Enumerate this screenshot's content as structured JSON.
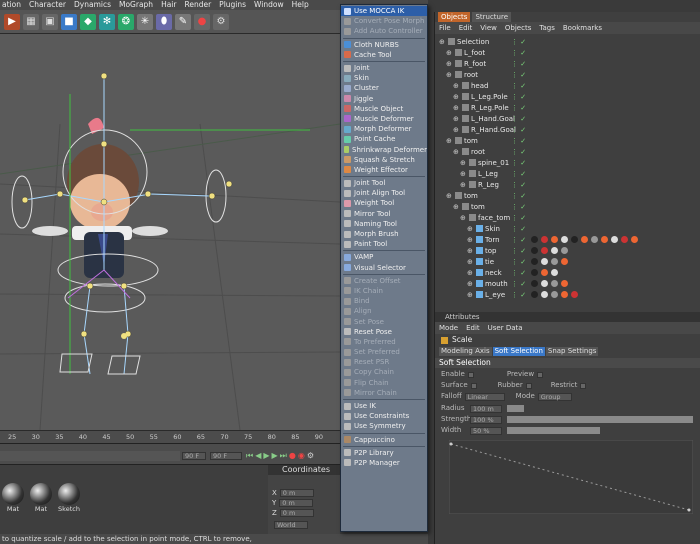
{
  "menubar": {
    "items": [
      "ation",
      "Character",
      "Dynamics",
      "MoGraph",
      "Hair",
      "Render",
      "Plugins",
      "Window",
      "Help"
    ]
  },
  "toolbar": {
    "icons": [
      "render-icon",
      "render-region-icon",
      "render-view-icon",
      "cube-icon",
      "nurbs-icon",
      "array-icon",
      "deformer-icon",
      "scene-icon",
      "light-icon",
      "camera-icon",
      "record-icon",
      "python-icon"
    ]
  },
  "viewport": {
    "ruler_ticks": [
      "25",
      "30",
      "35",
      "40",
      "45",
      "50",
      "55",
      "60",
      "65",
      "70",
      "75",
      "80",
      "85",
      "90"
    ]
  },
  "timeline": {
    "frame_a": "90 F",
    "frame_b": "90 F"
  },
  "materials": {
    "items": [
      "Mat",
      "Mat",
      "Sketch"
    ]
  },
  "coordinates": {
    "title": "Coordinates",
    "rows": [
      {
        "axis": "X",
        "value": "0 m"
      },
      {
        "axis": "Y",
        "value": "0 m"
      },
      {
        "axis": "Z",
        "value": "0 m"
      }
    ],
    "mode": "World"
  },
  "status": "to quantize scale / add to the selection in point mode, CTRL to remove,",
  "plugins_menu": {
    "items": [
      {
        "label": "Use MOCCA IK",
        "state": "sel",
        "color": "#cfe0ff"
      },
      {
        "label": "Convert Pose Morph",
        "state": "dis",
        "color": "#999"
      },
      {
        "label": "Add Auto Controller",
        "state": "dis",
        "color": "#999"
      },
      {
        "sep": true
      },
      {
        "label": "Cloth NURBS",
        "state": "",
        "color": "#4a8fd8"
      },
      {
        "label": "Cache Tool",
        "state": "",
        "color": "#d86a4a"
      },
      {
        "sep": true
      },
      {
        "label": "Joint",
        "state": "",
        "color": "#bbb"
      },
      {
        "label": "Skin",
        "state": "",
        "color": "#8ab"
      },
      {
        "label": "Cluster",
        "state": "",
        "color": "#9ac"
      },
      {
        "label": "Jiggle",
        "state": "",
        "color": "#c8a"
      },
      {
        "label": "Muscle Object",
        "state": "",
        "color": "#c66"
      },
      {
        "label": "Muscle Deformer",
        "state": "",
        "color": "#a6c"
      },
      {
        "label": "Morph Deformer",
        "state": "",
        "color": "#6ac"
      },
      {
        "label": "Point Cache",
        "state": "",
        "color": "#6ca"
      },
      {
        "label": "Shrinkwrap Deformer",
        "state": "",
        "color": "#ac6"
      },
      {
        "label": "Squash & Stretch",
        "state": "",
        "color": "#c96"
      },
      {
        "label": "Weight Effector",
        "state": "",
        "color": "#d84"
      },
      {
        "sep": true
      },
      {
        "label": "Joint Tool",
        "state": "",
        "color": "#bbb"
      },
      {
        "label": "Joint Align Tool",
        "state": "",
        "color": "#bbb"
      },
      {
        "label": "Weight Tool",
        "state": "",
        "color": "#d9a"
      },
      {
        "label": "Mirror Tool",
        "state": "",
        "color": "#bbb"
      },
      {
        "label": "Naming Tool",
        "state": "",
        "color": "#bbb"
      },
      {
        "label": "Morph Brush",
        "state": "",
        "color": "#bbb"
      },
      {
        "label": "Paint Tool",
        "state": "",
        "color": "#bbb"
      },
      {
        "sep": true
      },
      {
        "label": "VAMP",
        "state": "",
        "color": "#8ad"
      },
      {
        "label": "Visual Selector",
        "state": "",
        "color": "#8ad"
      },
      {
        "sep": true
      },
      {
        "label": "Create Offset",
        "state": "dis",
        "color": "#999"
      },
      {
        "label": "IK Chain",
        "state": "dis",
        "color": "#999"
      },
      {
        "label": "Bind",
        "state": "dis",
        "color": "#999"
      },
      {
        "label": "Align",
        "state": "dis",
        "color": "#999"
      },
      {
        "label": "Set Pose",
        "state": "dis",
        "color": "#999"
      },
      {
        "label": "Reset Pose",
        "state": "",
        "color": "#bbb"
      },
      {
        "label": "To Preferred",
        "state": "dis",
        "color": "#999"
      },
      {
        "label": "Set Preferred",
        "state": "dis",
        "color": "#999"
      },
      {
        "label": "Reset PSR",
        "state": "dis",
        "color": "#999"
      },
      {
        "label": "Copy Chain",
        "state": "dis",
        "color": "#999"
      },
      {
        "label": "Flip Chain",
        "state": "dis",
        "color": "#999"
      },
      {
        "label": "Mirror Chain",
        "state": "dis",
        "color": "#999"
      },
      {
        "sep": true
      },
      {
        "label": "Use IK",
        "state": "",
        "color": "#bbb"
      },
      {
        "label": "Use Constraints",
        "state": "",
        "color": "#bbb"
      },
      {
        "label": "Use Symmetry",
        "state": "",
        "color": "#bbb"
      },
      {
        "sep": true
      },
      {
        "label": "Cappuccino",
        "state": "",
        "color": "#a86"
      },
      {
        "sep": true
      },
      {
        "label": "P2P Library",
        "state": "",
        "color": "#bbb"
      },
      {
        "label": "P2P Manager",
        "state": "",
        "color": "#bbb"
      }
    ]
  },
  "objects_panel": {
    "tabs": [
      "Objects",
      "Structure"
    ],
    "menu": [
      "File",
      "Edit",
      "View",
      "Objects",
      "Tags",
      "Bookmarks"
    ],
    "rows": [
      {
        "name": "Selection",
        "indent": 0,
        "tags": []
      },
      {
        "name": "L_foot",
        "indent": 1,
        "tags": []
      },
      {
        "name": "R_foot",
        "indent": 1,
        "tags": []
      },
      {
        "name": "root",
        "indent": 1,
        "tags": []
      },
      {
        "name": "head",
        "indent": 2,
        "tags": []
      },
      {
        "name": "L_Leg.Pole",
        "indent": 2,
        "tags": []
      },
      {
        "name": "R_Leg.Pole",
        "indent": 2,
        "tags": []
      },
      {
        "name": "L_Hand.Goal",
        "indent": 2,
        "tags": []
      },
      {
        "name": "R_Hand.Goal",
        "indent": 2,
        "tags": []
      },
      {
        "name": "tom",
        "indent": 1,
        "tags": []
      },
      {
        "name": "root",
        "indent": 2,
        "tags": []
      },
      {
        "name": "spine_01",
        "indent": 3,
        "tags": []
      },
      {
        "name": "L_Leg",
        "indent": 3,
        "tags": []
      },
      {
        "name": "R_Leg",
        "indent": 3,
        "tags": []
      },
      {
        "name": "tom",
        "indent": 1,
        "tags": []
      },
      {
        "name": "tom",
        "indent": 2,
        "tags": []
      },
      {
        "name": "face_tom",
        "indent": 3,
        "tags": []
      },
      {
        "name": "Skin",
        "indent": 4,
        "tags": []
      },
      {
        "name": "Torn",
        "indent": 4,
        "tags": [
          "#222",
          "#c33",
          "#e63",
          "#ddd",
          "#222",
          "#e63",
          "#999",
          "#e63",
          "#ddd",
          "#c33",
          "#e63"
        ]
      },
      {
        "name": "top",
        "indent": 4,
        "tags": [
          "#222",
          "#c33",
          "#ddd",
          "#999"
        ]
      },
      {
        "name": "tie",
        "indent": 4,
        "tags": [
          "#222",
          "#ddd",
          "#999",
          "#e63"
        ]
      },
      {
        "name": "neck",
        "indent": 4,
        "tags": [
          "#222",
          "#e63",
          "#ddd"
        ]
      },
      {
        "name": "mouth",
        "indent": 4,
        "tags": [
          "#222",
          "#ddd",
          "#999",
          "#e63"
        ]
      },
      {
        "name": "L_eye",
        "indent": 4,
        "tags": [
          "#222",
          "#ddd",
          "#999",
          "#e63",
          "#c33"
        ]
      }
    ]
  },
  "attributes_panel": {
    "header": "Attributes",
    "menu": [
      "Mode",
      "Edit",
      "User Data"
    ],
    "object": "Scale",
    "tabs": [
      "Modeling Axis",
      "Soft Selection",
      "Snap Settings"
    ],
    "section": "Soft Selection",
    "enable": "Enable",
    "preview": "Preview",
    "surface": "Surface",
    "rubber": "Rubber",
    "restrict": "Restrict",
    "falloff_label": "Falloff",
    "falloff_value": "Linear",
    "mode_label": "Mode",
    "mode_value": "Group",
    "radius_label": "Radius",
    "radius_value": "100 m",
    "strength_label": "Strength",
    "strength_value": "100 %",
    "width_label": "Width",
    "width_value": "50 %",
    "strength_fraction": 1.0,
    "width_fraction": 0.5,
    "radius_fraction": 0.09
  }
}
